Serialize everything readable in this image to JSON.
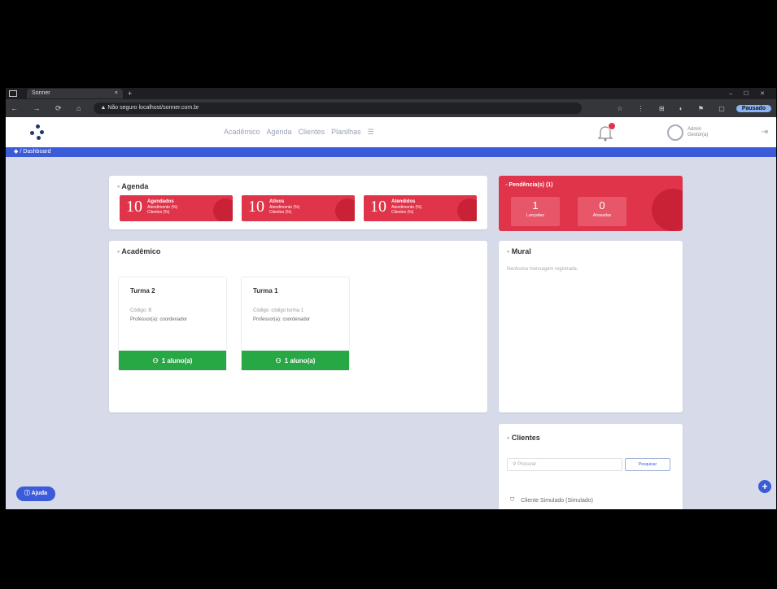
{
  "browser": {
    "tab_title": "Sonner",
    "tab_close": "×",
    "new_tab": "+",
    "window_controls": "– ☐ ✕",
    "nav_icons": "← → ⟳ ⌂",
    "url_prefix": "▲ Não seguro",
    "url": "localhost/sonner.com.br",
    "ext_icons": "☆ ⋮ ⊞ ◐ ⚑ ▢",
    "profile": "Pausado"
  },
  "header": {
    "nav": [
      "Acadêmico",
      "Agenda",
      "Clientes",
      "Planilhas",
      "☰"
    ],
    "user_name": "Admin",
    "user_role": "Gestor(a)",
    "logout_icon": "⇥"
  },
  "breadcrumb": "◆ / Dashboard",
  "agenda": {
    "title": "◦ Agenda",
    "stats": [
      {
        "num": "10",
        "l1": "Agendados",
        "l2": "Atendimento (%)",
        "l3": "Clientes (%)"
      },
      {
        "num": "10",
        "l1": "Ativos",
        "l2": "Atendimento (%)",
        "l3": "Clientes (%)"
      },
      {
        "num": "10",
        "l1": "Atendidos",
        "l2": "Atendimento (%)",
        "l3": "Clientes (%)"
      }
    ]
  },
  "pendencias": {
    "title": "◦ Pendência(s) (1)",
    "items": [
      {
        "num": "1",
        "label": "Lançadas"
      },
      {
        "num": "0",
        "label": "Atrasadas"
      }
    ]
  },
  "academico": {
    "title": "◦ Acadêmico",
    "turmas": [
      {
        "title": "Turma 2",
        "code": "Código: B",
        "prof": "Professor(a): coordenador",
        "alunos": "1 aluno(a)"
      },
      {
        "title": "Turma 1",
        "code": "Código: código turma 1",
        "prof": "Professor(a): coordenador",
        "alunos": "1 aluno(a)"
      }
    ]
  },
  "mural": {
    "title": "◦ Mural",
    "empty": "Nenhuma mensagem registrada."
  },
  "clientes": {
    "title": "◦ Clientes",
    "search_placeholder": "Procurar",
    "search_button": "Pesquisar",
    "first_client": "Cliente Simulado (Simulado)"
  },
  "ajuda": "ⓘ Ajuda",
  "fab": "+",
  "colors": {
    "primary": "#3b5bd8",
    "danger": "#e0344a",
    "success": "#28a745"
  }
}
